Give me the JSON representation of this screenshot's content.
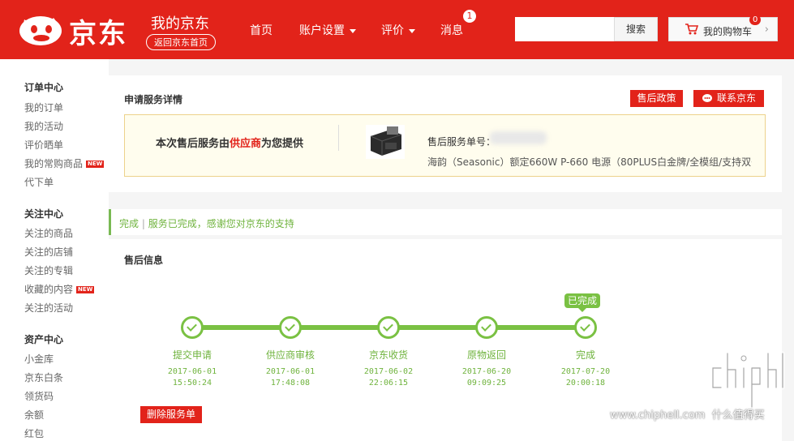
{
  "header": {
    "brand": "京东",
    "site_title": "我的京东",
    "back_home": "返回京东首页",
    "nav": [
      {
        "label": "首页"
      },
      {
        "label": "账户设置"
      },
      {
        "label": "评价"
      },
      {
        "label": "消息"
      }
    ],
    "message_count": "1",
    "search_placeholder": "",
    "search_button": "搜索",
    "cart_label": "我的购物车",
    "cart_count": "0"
  },
  "sidebar": {
    "groups": [
      {
        "title": "订单中心",
        "items": [
          "我的订单",
          "我的活动",
          "评价晒单",
          "我的常购商品",
          "代下单"
        ]
      },
      {
        "title": "关注中心",
        "items": [
          "关注的商品",
          "关注的店铺",
          "关注的专辑",
          "收藏的内容",
          "关注的活动"
        ]
      },
      {
        "title": "资产中心",
        "items": [
          "小金库",
          "京东白条",
          "领货码",
          "余额",
          "红包"
        ]
      }
    ],
    "new_tag": "NEW"
  },
  "service_detail": {
    "title": "申请服务详情",
    "policy_button": "售后政策",
    "contact_button": "联系京东",
    "provider_prefix": "本次售后服务由",
    "provider_name": "供应商",
    "provider_suffix": "为您提供",
    "service_no_label": "售后服务单号：",
    "product_name": "海韵（Seasonic）额定660W P-660 电源（80PLUS白金牌/全模组/支持双CPU/支"
  },
  "status": {
    "state": "完成",
    "separator": "|",
    "message": "服务已完成，感谢您对京东的支持"
  },
  "after_sale": {
    "title": "售后信息",
    "done_badge": "已完成",
    "steps": [
      {
        "label": "提交申请",
        "date": "2017-06-01",
        "time": "15:50:24"
      },
      {
        "label": "供应商审核",
        "date": "2017-06-01",
        "time": "17:48:08"
      },
      {
        "label": "京东收货",
        "date": "2017-06-02",
        "time": "22:06:15"
      },
      {
        "label": "原物返回",
        "date": "2017-06-20",
        "time": "09:09:25"
      },
      {
        "label": "完成",
        "date": "2017-07-20",
        "time": "20:00:18"
      }
    ],
    "delete_button": "删除服务单"
  },
  "watermark": "www.chiphell.com",
  "watermark_tail": "什么值得买",
  "colors": {
    "brand_red": "#e2231a",
    "progress_green": "#7ac143",
    "notice_yellow": "#fffdee"
  }
}
